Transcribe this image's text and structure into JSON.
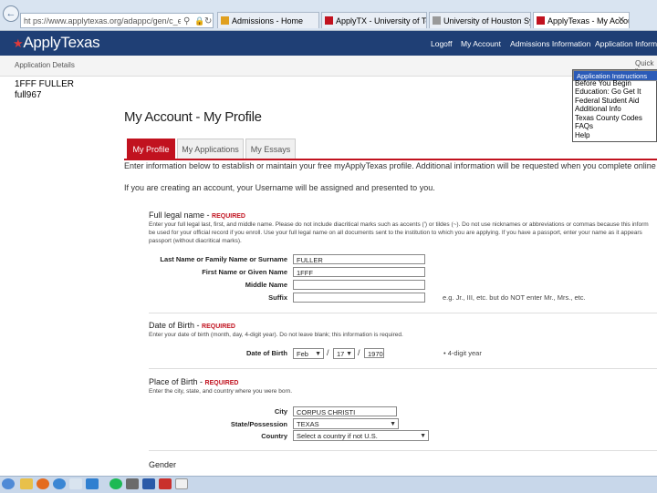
{
  "browser": {
    "url": "ht ps://www.applytexas.org/adappc/gen/c_edit...",
    "tabs": [
      {
        "label": "Admissions - Home",
        "color": "#e0a020"
      },
      {
        "label": "ApplyTX - University of Texas...",
        "color": "#c1121f"
      },
      {
        "label": "University of Houston System",
        "color": "#999999"
      },
      {
        "label": "ApplyTexas - My Account...",
        "color": "#c1121f"
      }
    ],
    "close_glyph": "✕"
  },
  "header": {
    "logo": "ApplyTexas",
    "nav": [
      "Logoff",
      "My Account",
      "Admissions Information",
      "Application Information"
    ]
  },
  "app_details": {
    "label": "Application Details",
    "name": "1FFF FULLER",
    "user_id": "full967",
    "quick_label": "Quick li"
  },
  "quick_list": [
    "Application Instructions",
    "Before You Begin",
    "Education: Go Get It",
    "Federal Student Aid",
    "Additional Info",
    "Texas County Codes",
    "FAQs",
    "Help"
  ],
  "page": {
    "title": "My Account - My Profile",
    "tabs": [
      "My Profile",
      "My Applications",
      "My Essays"
    ],
    "intro": "Enter information below to establish or maintain your free myApplyTexas profile. Additional information will be requested when you complete online applications.",
    "username_note": "If you are creating an account, your Username will be assigned and presented to you."
  },
  "legal_name": {
    "heading": "Full legal name - ",
    "required": "REQUIRED",
    "help1": "Enter your full legal last, first, and middle name. Please do not include diacritical marks such as accents (') or tildes (~). Do not use nicknames or abbreviations or commas because this inform",
    "help2": "be used for your official record if you enroll. Use your full legal name on all documents sent to the institution to which you are applying. If you have a passport, enter your name as it appears",
    "help3": "passport (without diacritical marks).",
    "last_label": "Last Name or Family Name or Surname",
    "last_value": "FULLER",
    "first_label": "First Name or Given Name",
    "first_value": "1FFF",
    "middle_label": "Middle Name",
    "middle_value": "",
    "suffix_label": "Suffix",
    "suffix_value": "",
    "suffix_hint": "e.g. Jr., III, etc. but do NOT enter Mr., Mrs., etc."
  },
  "dob": {
    "heading": "Date of Birth - ",
    "required": "REQUIRED",
    "help": "Enter your date of birth (month, day, 4-digit year). Do not leave blank; this information is required.",
    "label": "Date of Birth",
    "month": "Feb",
    "day": "17",
    "year": "1970",
    "slash": "/",
    "hint": "4-digit year"
  },
  "birthplace": {
    "heading": "Place of Birth - ",
    "required": "REQUIRED",
    "help": "Enter the city, state, and country where you were born.",
    "city_label": "City",
    "city_value": "CORPUS CHRISTI",
    "state_label": "State/Possession",
    "state_value": "TEXAS",
    "country_label": "Country",
    "country_value": "Select a country if not U.S."
  },
  "gender": {
    "heading": "Gender"
  },
  "colors": {
    "accent": "#c1121f",
    "header": "#1f3f75",
    "selection": "#2b5bb8"
  },
  "taskbar_icons": [
    "start-orb",
    "explorer-folder-icon",
    "firefox-icon",
    "ie-icon",
    "mail-icon",
    "spotify-icon",
    "media-icon",
    "word-icon",
    "pdf-icon"
  ]
}
